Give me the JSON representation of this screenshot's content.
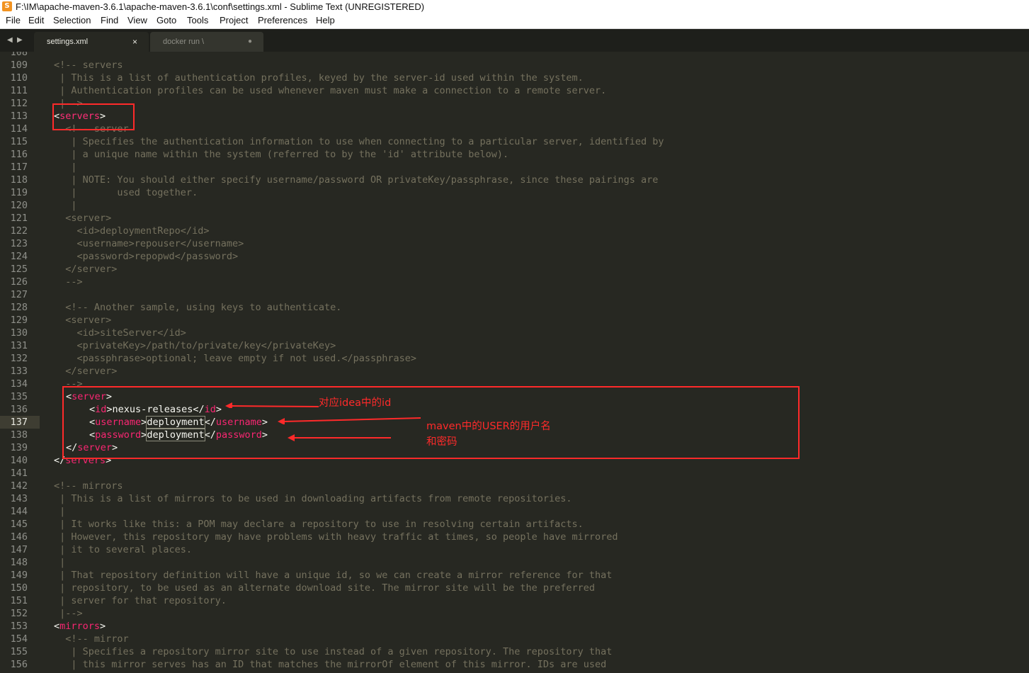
{
  "window": {
    "app_icon": "sublime-text-icon",
    "title": "F:\\IM\\apache-maven-3.6.1\\apache-maven-3.6.1\\conf\\settings.xml - Sublime Text (UNREGISTERED)"
  },
  "menu": [
    "File",
    "Edit",
    "Selection",
    "Find",
    "View",
    "Goto",
    "Tools",
    "Project",
    "Preferences",
    "Help"
  ],
  "tabs": [
    {
      "label": "settings.xml",
      "close": "×",
      "active": true
    },
    {
      "label": "docker run \\",
      "close": "●",
      "active": false
    }
  ],
  "editor": {
    "current_line": 137,
    "lines": [
      {
        "n": "108",
        "code": ""
      },
      {
        "n": "109",
        "code": "<!-- servers"
      },
      {
        "n": "110",
        "code": " | This is a list of authentication profiles, keyed by the server-id used within the system."
      },
      {
        "n": "111",
        "code": " | Authentication profiles can be used whenever maven must make a connection to a remote server."
      },
      {
        "n": "112",
        "code": " |-->"
      },
      {
        "n": "113",
        "code": "<servers>"
      },
      {
        "n": "114",
        "code": "  <!-- server"
      },
      {
        "n": "115",
        "code": "   | Specifies the authentication information to use when connecting to a particular server, identified by"
      },
      {
        "n": "116",
        "code": "   | a unique name within the system (referred to by the 'id' attribute below)."
      },
      {
        "n": "117",
        "code": "   |"
      },
      {
        "n": "118",
        "code": "   | NOTE: You should either specify username/password OR privateKey/passphrase, since these pairings are"
      },
      {
        "n": "119",
        "code": "   |       used together."
      },
      {
        "n": "120",
        "code": "   |"
      },
      {
        "n": "121",
        "code": "  <server>"
      },
      {
        "n": "122",
        "code": "    <id>deploymentRepo</id>"
      },
      {
        "n": "123",
        "code": "    <username>repouser</username>"
      },
      {
        "n": "124",
        "code": "    <password>repopwd</password>"
      },
      {
        "n": "125",
        "code": "  </server>"
      },
      {
        "n": "126",
        "code": "  -->"
      },
      {
        "n": "127",
        "code": ""
      },
      {
        "n": "128",
        "code": "  <!-- Another sample, using keys to authenticate."
      },
      {
        "n": "129",
        "code": "  <server>"
      },
      {
        "n": "130",
        "code": "    <id>siteServer</id>"
      },
      {
        "n": "131",
        "code": "    <privateKey>/path/to/private/key</privateKey>"
      },
      {
        "n": "132",
        "code": "    <passphrase>optional; leave empty if not used.</passphrase>"
      },
      {
        "n": "133",
        "code": "  </server>"
      },
      {
        "n": "134",
        "code": "  -->"
      },
      {
        "n": "135",
        "code": ""
      },
      {
        "n": "136",
        "code": ""
      },
      {
        "n": "137",
        "code": ""
      },
      {
        "n": "138",
        "code": ""
      },
      {
        "n": "139",
        "code": ""
      },
      {
        "n": "140",
        "code": ""
      },
      {
        "n": "141",
        "code": ""
      },
      {
        "n": "142",
        "code": "<!-- mirrors"
      },
      {
        "n": "143",
        "code": " | This is a list of mirrors to be used in downloading artifacts from remote repositories."
      },
      {
        "n": "144",
        "code": " |"
      },
      {
        "n": "145",
        "code": " | It works like this: a POM may declare a repository to use in resolving certain artifacts."
      },
      {
        "n": "146",
        "code": " | However, this repository may have problems with heavy traffic at times, so people have mirrored"
      },
      {
        "n": "147",
        "code": " | it to several places."
      },
      {
        "n": "148",
        "code": " |"
      },
      {
        "n": "149",
        "code": " | That repository definition will have a unique id, so we can create a mirror reference for that"
      },
      {
        "n": "150",
        "code": " | repository, to be used as an alternate download site. The mirror site will be the preferred"
      },
      {
        "n": "151",
        "code": " | server for that repository."
      },
      {
        "n": "152",
        "code": " |-->"
      },
      {
        "n": "153",
        "code": ""
      },
      {
        "n": "154",
        "code": "  <!-- mirror"
      },
      {
        "n": "155",
        "code": "   | Specifies a repository mirror site to use instead of a given repository. The repository that"
      },
      {
        "n": "156",
        "code": "   | this mirror serves has an ID that matches the mirrorOf element of this mirror. IDs are used"
      }
    ],
    "servers_open": {
      "lt": "<",
      "name": "servers",
      "gt": ">"
    },
    "server_block": {
      "server_open": {
        "lt": "<",
        "name": "server",
        "gt": ">"
      },
      "id_line": {
        "open_lt": "<",
        "open": "id",
        "open_gt": ">",
        "value": "nexus-releases",
        "close_lt": "</",
        "close": "id",
        "close_gt": ">"
      },
      "username_line": {
        "open_lt": "<",
        "open": "username",
        "open_gt": ">",
        "value": "deployment",
        "close_lt": "</",
        "close": "username",
        "close_gt": ">"
      },
      "password_line": {
        "open_lt": "<",
        "open": "password",
        "open_gt": ">",
        "value": "deployment",
        "close_lt": "</",
        "close": "password",
        "close_gt": ">"
      },
      "server_close": {
        "lt": "</",
        "name": "server",
        "gt": ">"
      }
    },
    "servers_close": {
      "lt": "</",
      "name": "servers",
      "gt": ">"
    },
    "mirrors_open": {
      "lt": "<",
      "name": "mirrors",
      "gt": ">"
    }
  },
  "annotations": {
    "id_note": "对应idea中的id",
    "user_note_line1": "maven中的USER的用户名",
    "user_note_line2": "和密码",
    "color": "#ff2a2a"
  },
  "colors": {
    "background": "#272822",
    "comment": "#75715e",
    "tag": "#f92672",
    "text": "#f8f8f2",
    "line_number": "#8f908a"
  }
}
